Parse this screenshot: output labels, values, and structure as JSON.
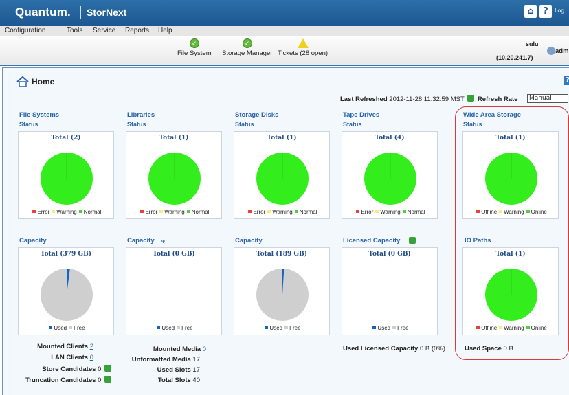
{
  "app": {
    "brand": "Quantum.",
    "product": "StorNext",
    "logout": "Log"
  },
  "menu": [
    "Configuration",
    "Tools",
    "Service",
    "Reports",
    "Help"
  ],
  "status": {
    "filesystem": "File System",
    "storage_manager": "Storage Manager",
    "tickets": "Tickets (28 open)"
  },
  "server": {
    "name": "sulu",
    "ip": "(10.20.241.7)",
    "user": "adm"
  },
  "page": {
    "title": "Home",
    "last_refreshed_label": "Last Refreshed",
    "last_refreshed_value": "2012-11-28 11:32:59 MST",
    "refresh_rate_label": "Refresh Rate",
    "refresh_rate_value": "Manual"
  },
  "colors": {
    "error": "#e8403e",
    "warning": "#f8ec7d",
    "normal": "#4dd23c",
    "green": "#33ee1c",
    "used": "#1565c0",
    "free": "#cfcfcf"
  },
  "status_panels": [
    {
      "section": "File Systems",
      "sub": "Status",
      "total": "Total (2)",
      "legend": [
        "Error",
        "Warning",
        "Normal"
      ]
    },
    {
      "section": "Libraries",
      "sub": "Status",
      "total": "Total (1)",
      "legend": [
        "Error",
        "Warning",
        "Normal"
      ]
    },
    {
      "section": "Storage Disks",
      "sub": "Status",
      "total": "Total (1)",
      "legend": [
        "Error",
        "Warning",
        "Normal"
      ]
    },
    {
      "section": "Tape Drives",
      "sub": "Status",
      "total": "Total (4)",
      "legend": [
        "Error",
        "Warning",
        "Normal"
      ]
    },
    {
      "section": "Wide Area Storage",
      "sub": "Status",
      "total": "Total (1)",
      "legend": [
        "Offline",
        "Warning",
        "Online"
      ]
    }
  ],
  "capacity_panels": [
    {
      "section": "Capacity",
      "total": "Total (379 GB)",
      "legend": [
        "Used",
        "Free"
      ],
      "used_fraction": 0.02
    },
    {
      "section": "Capacity",
      "total": "Total (0 GB)",
      "legend": [
        "Used",
        "Free"
      ],
      "used_fraction": 0
    },
    {
      "section": "Capacity",
      "total": "Total (189 GB)",
      "legend": [
        "Used",
        "Free"
      ],
      "used_fraction": 0.01
    },
    {
      "section": "Licensed Capacity",
      "total": "Total (0 GB)",
      "legend": [
        "Used",
        "Free"
      ],
      "used_fraction": 0
    },
    {
      "section": "IO Paths",
      "total": "Total (1)",
      "legend": [
        "Offline",
        "Warning",
        "Online"
      ]
    }
  ],
  "fs_stats": [
    {
      "label": "Mounted Clients",
      "value": "2"
    },
    {
      "label": "LAN Clients",
      "value": "0"
    },
    {
      "label": "Store Candidates",
      "value": "0"
    },
    {
      "label": "Truncation Candidates",
      "value": "0"
    }
  ],
  "lib_stats": [
    {
      "label": "Mounted Media",
      "value": "0"
    },
    {
      "label": "Unformatted Media",
      "value": "17"
    },
    {
      "label": "Used Slots",
      "value": "17"
    },
    {
      "label": "Total Slots",
      "value": "40"
    }
  ],
  "licensed_used": {
    "label": "Used Licensed Capacity",
    "value": "0 B (0%)"
  },
  "used_space": {
    "label": "Used Space",
    "value": "0 B"
  }
}
